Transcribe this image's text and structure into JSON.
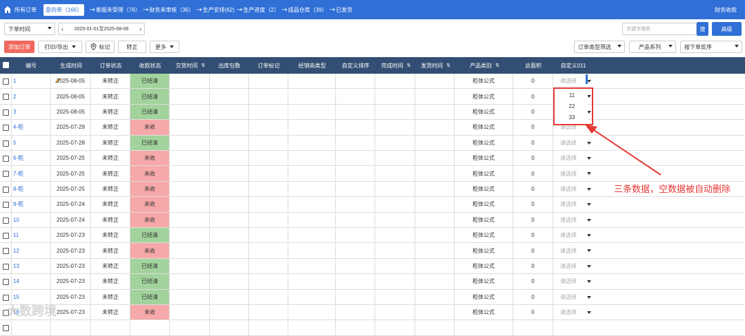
{
  "nav": {
    "items": [
      {
        "label": "所有订单"
      },
      {
        "label": "意向单（166）"
      },
      {
        "label": "客服未受理（76）"
      },
      {
        "label": "财务未审核（36）"
      },
      {
        "label": "生产安排(62)"
      },
      {
        "label": "生产进度（2）"
      },
      {
        "label": "成品仓库（39）"
      },
      {
        "label": "已发货"
      }
    ],
    "right_label": "财务收款"
  },
  "filters": {
    "time_type": "下单时间",
    "date_range": "2025-01-01至2025-08-06",
    "keyword_placeholder": "关键字搜索",
    "search_label": "搜",
    "advanced_label": "高级",
    "order_type_filter": "订单类型筛选",
    "product_series": "产品系列",
    "sort_order": "按下单反序"
  },
  "toolbar": {
    "add_label": "添加订单",
    "print_label": "打印/导出",
    "mark_label": "标记",
    "convert_label": "转正",
    "more_label": "更多"
  },
  "table": {
    "columns": [
      "编号",
      "生成时间",
      "订单状态",
      "收款状态",
      "交货时间",
      "出库包数",
      "订单标记",
      "经销商类型",
      "自定义排序",
      "完成时间",
      "发货时间",
      "产品类别",
      "总面积",
      "自定义011"
    ],
    "select_placeholder": "请选择",
    "rows": [
      {
        "id": "1",
        "date": "2025-08-05",
        "status": "未转正",
        "pay": "已结清",
        "paid": true,
        "category": "柜体公式",
        "area": "0"
      },
      {
        "id": "2",
        "date": "2025-08-05",
        "status": "未转正",
        "pay": "已结清",
        "paid": true,
        "category": "柜体公式",
        "area": "0"
      },
      {
        "id": "3",
        "date": "2025-08-05",
        "status": "未转正",
        "pay": "已结清",
        "paid": true,
        "category": "柜体公式",
        "area": "0"
      },
      {
        "id": "4-柜",
        "date": "2025-07-29",
        "status": "未转正",
        "pay": "未收",
        "paid": false,
        "category": "柜体公式",
        "area": "0"
      },
      {
        "id": "5",
        "date": "2025-07-28",
        "status": "未转正",
        "pay": "已结清",
        "paid": true,
        "category": "柜体公式",
        "area": "0"
      },
      {
        "id": "6-柜",
        "date": "2025-07-25",
        "status": "未转正",
        "pay": "未收",
        "paid": false,
        "category": "柜体公式",
        "area": "0"
      },
      {
        "id": "7-柜",
        "date": "2025-07-25",
        "status": "未转正",
        "pay": "未收",
        "paid": false,
        "category": "柜体公式",
        "area": "0"
      },
      {
        "id": "8-柜",
        "date": "2025-07-25",
        "status": "未转正",
        "pay": "未收",
        "paid": false,
        "category": "柜体公式",
        "area": "0"
      },
      {
        "id": "9-柜",
        "date": "2025-07-24",
        "status": "未转正",
        "pay": "未收",
        "paid": false,
        "category": "柜体公式",
        "area": "0"
      },
      {
        "id": "10",
        "date": "2025-07-24",
        "status": "未转正",
        "pay": "未收",
        "paid": false,
        "category": "柜体公式",
        "area": "0"
      },
      {
        "id": "11",
        "date": "2025-07-23",
        "status": "未转正",
        "pay": "已结清",
        "paid": true,
        "category": "柜体公式",
        "area": "0"
      },
      {
        "id": "12",
        "date": "2025-07-23",
        "status": "未转正",
        "pay": "未收",
        "paid": false,
        "category": "柜体公式",
        "area": "0"
      },
      {
        "id": "13",
        "date": "2025-07-23",
        "status": "未转正",
        "pay": "已结清",
        "paid": true,
        "category": "柜体公式",
        "area": "0"
      },
      {
        "id": "14",
        "date": "2025-07-23",
        "status": "未转正",
        "pay": "已结清",
        "paid": true,
        "category": "柜体公式",
        "area": "0"
      },
      {
        "id": "15",
        "date": "2025-07-23",
        "status": "未转正",
        "pay": "已结清",
        "paid": true,
        "category": "柜体公式",
        "area": "0"
      },
      {
        "id": "16",
        "date": "2025-07-23",
        "status": "未转正",
        "pay": "未收",
        "paid": false,
        "category": "柜体公式",
        "area": "0"
      },
      {
        "id": "",
        "date": "",
        "status": "",
        "pay": "",
        "paid": true,
        "category": "",
        "area": ""
      }
    ]
  },
  "dropdown": {
    "options": [
      "11",
      "22",
      "33"
    ]
  },
  "annotation": {
    "text": "三条数据，空数据被自动删除"
  },
  "watermark": "大数跨境",
  "colors": {
    "nav_blue": "#2f6fd6",
    "header_navy": "#324e73",
    "paid_green": "#a3d39c",
    "unpaid_pink": "#f7a8a8",
    "annotation_red": "#e53935",
    "add_button_red": "#f0695f"
  }
}
